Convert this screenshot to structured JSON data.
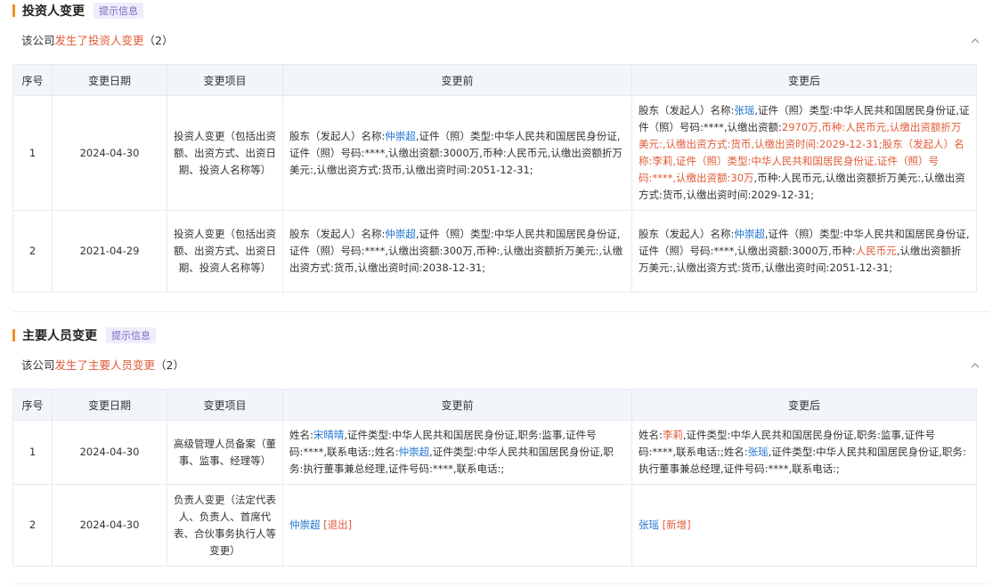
{
  "colors": {
    "accent": "#f28c28",
    "link": "#1f74d1",
    "highlight": "#e15a36",
    "tag": "#7b68c6"
  },
  "icons": {
    "collapse": "chevron-up-icon"
  },
  "sections": [
    {
      "title": "投资人变更",
      "tag": "提示信息",
      "summary_prefix": "该公司",
      "summary_highlight": "发生了投资人变更",
      "summary_count": "（2）",
      "columns": [
        "序号",
        "变更日期",
        "变更项目",
        "变更前",
        "变更后"
      ],
      "rows": [
        {
          "index": "1",
          "date": "2024-04-30",
          "item": "投资人变更（包括出资额、出资方式、出资日期、投资人名称等）",
          "before": [
            {
              "t": "股东（发起人）名称:"
            },
            {
              "t": "仲崇超",
              "c": "blue"
            },
            {
              "t": ",证件（照）类型:中华人民共和国居民身份证,证件（照）号码:****,认缴出资额:3000万,币种:人民币元,认缴出资额折万美元:,认缴出资方式:货币,认缴出资时间:2051-12-31;"
            }
          ],
          "after": [
            {
              "t": "股东（发起人）名称:"
            },
            {
              "t": "张瑶",
              "c": "blue"
            },
            {
              "t": ",证件（照）类型:中华人民共和国居民身份证,证件（照）号码:****,认缴出资额:"
            },
            {
              "t": "2970万,币种:人民币元,认缴出资额折万美元:,认缴出资方式:货币,认缴出资时间:2029-12-31;股东（发起人）名称:",
              "c": "red"
            },
            {
              "t": "李莉",
              "c": "red"
            },
            {
              "t": ",证件（照）类型:中华人民共和国居民身份证,证件（照）号码:****,认缴出资额:30万",
              "c": "red"
            },
            {
              "t": ",币种:人民币元,认缴出资额折万美元:,认缴出资方式:货币,认缴出资时间:2029-12-31;"
            }
          ]
        },
        {
          "index": "2",
          "date": "2021-04-29",
          "item": "投资人变更（包括出资额、出资方式、出资日期、投资人名称等）",
          "before": [
            {
              "t": "股东（发起人）名称:"
            },
            {
              "t": "仲崇超",
              "c": "blue"
            },
            {
              "t": ",证件（照）类型:中华人民共和国居民身份证,证件（照）号码:****,认缴出资额:300万,币种:,认缴出资额折万美元:,认缴出资方式:货币,认缴出资时间:2038-12-31;"
            }
          ],
          "after": [
            {
              "t": "股东（发起人）名称:"
            },
            {
              "t": "仲崇超",
              "c": "blue"
            },
            {
              "t": ",证件（照）类型:中华人民共和国居民身份证,证件（照）号码:****,认缴出资额:3000万,币种:"
            },
            {
              "t": "人民币元",
              "c": "red"
            },
            {
              "t": ",认缴出资额折万美元:,认缴出资方式:货币,认缴出资时间:2051-12-31;"
            }
          ]
        }
      ]
    },
    {
      "title": "主要人员变更",
      "tag": "提示信息",
      "summary_prefix": "该公司",
      "summary_highlight": "发生了主要人员变更",
      "summary_count": "（2）",
      "columns": [
        "序号",
        "变更日期",
        "变更项目",
        "变更前",
        "变更后"
      ],
      "rows": [
        {
          "index": "1",
          "date": "2024-04-30",
          "item": "高级管理人员备案（董事、监事、经理等）",
          "before": [
            {
              "t": "姓名:"
            },
            {
              "t": "宋晴晴",
              "c": "blue"
            },
            {
              "t": ",证件类型:中华人民共和国居民身份证,职务:监事,证件号码:****,联系电话:;姓名:"
            },
            {
              "t": "仲崇超",
              "c": "blue"
            },
            {
              "t": ",证件类型:中华人民共和国居民身份证,职务:执行董事兼总经理,证件号码:****,联系电话:;"
            }
          ],
          "after": [
            {
              "t": "姓名:"
            },
            {
              "t": "李莉",
              "c": "red"
            },
            {
              "t": ",证件类型:中华人民共和国居民身份证,职务:监事,证件号码:****,联系电话:;姓名:"
            },
            {
              "t": "张瑶",
              "c": "blue"
            },
            {
              "t": ",证件类型:中华人民共和国居民身份证,职务:执行董事兼总经理,证件号码:****,联系电话:;"
            }
          ]
        },
        {
          "index": "2",
          "date": "2024-04-30",
          "item": "负责人变更（法定代表人、负责人、首席代表、合伙事务执行人等变更）",
          "before": [
            {
              "t": "仲崇超",
              "c": "blue"
            },
            {
              "t": " [退出]",
              "c": "red"
            }
          ],
          "after": [
            {
              "t": "张瑶",
              "c": "blue"
            },
            {
              "t": " [新增]",
              "c": "red"
            }
          ]
        }
      ]
    }
  ]
}
